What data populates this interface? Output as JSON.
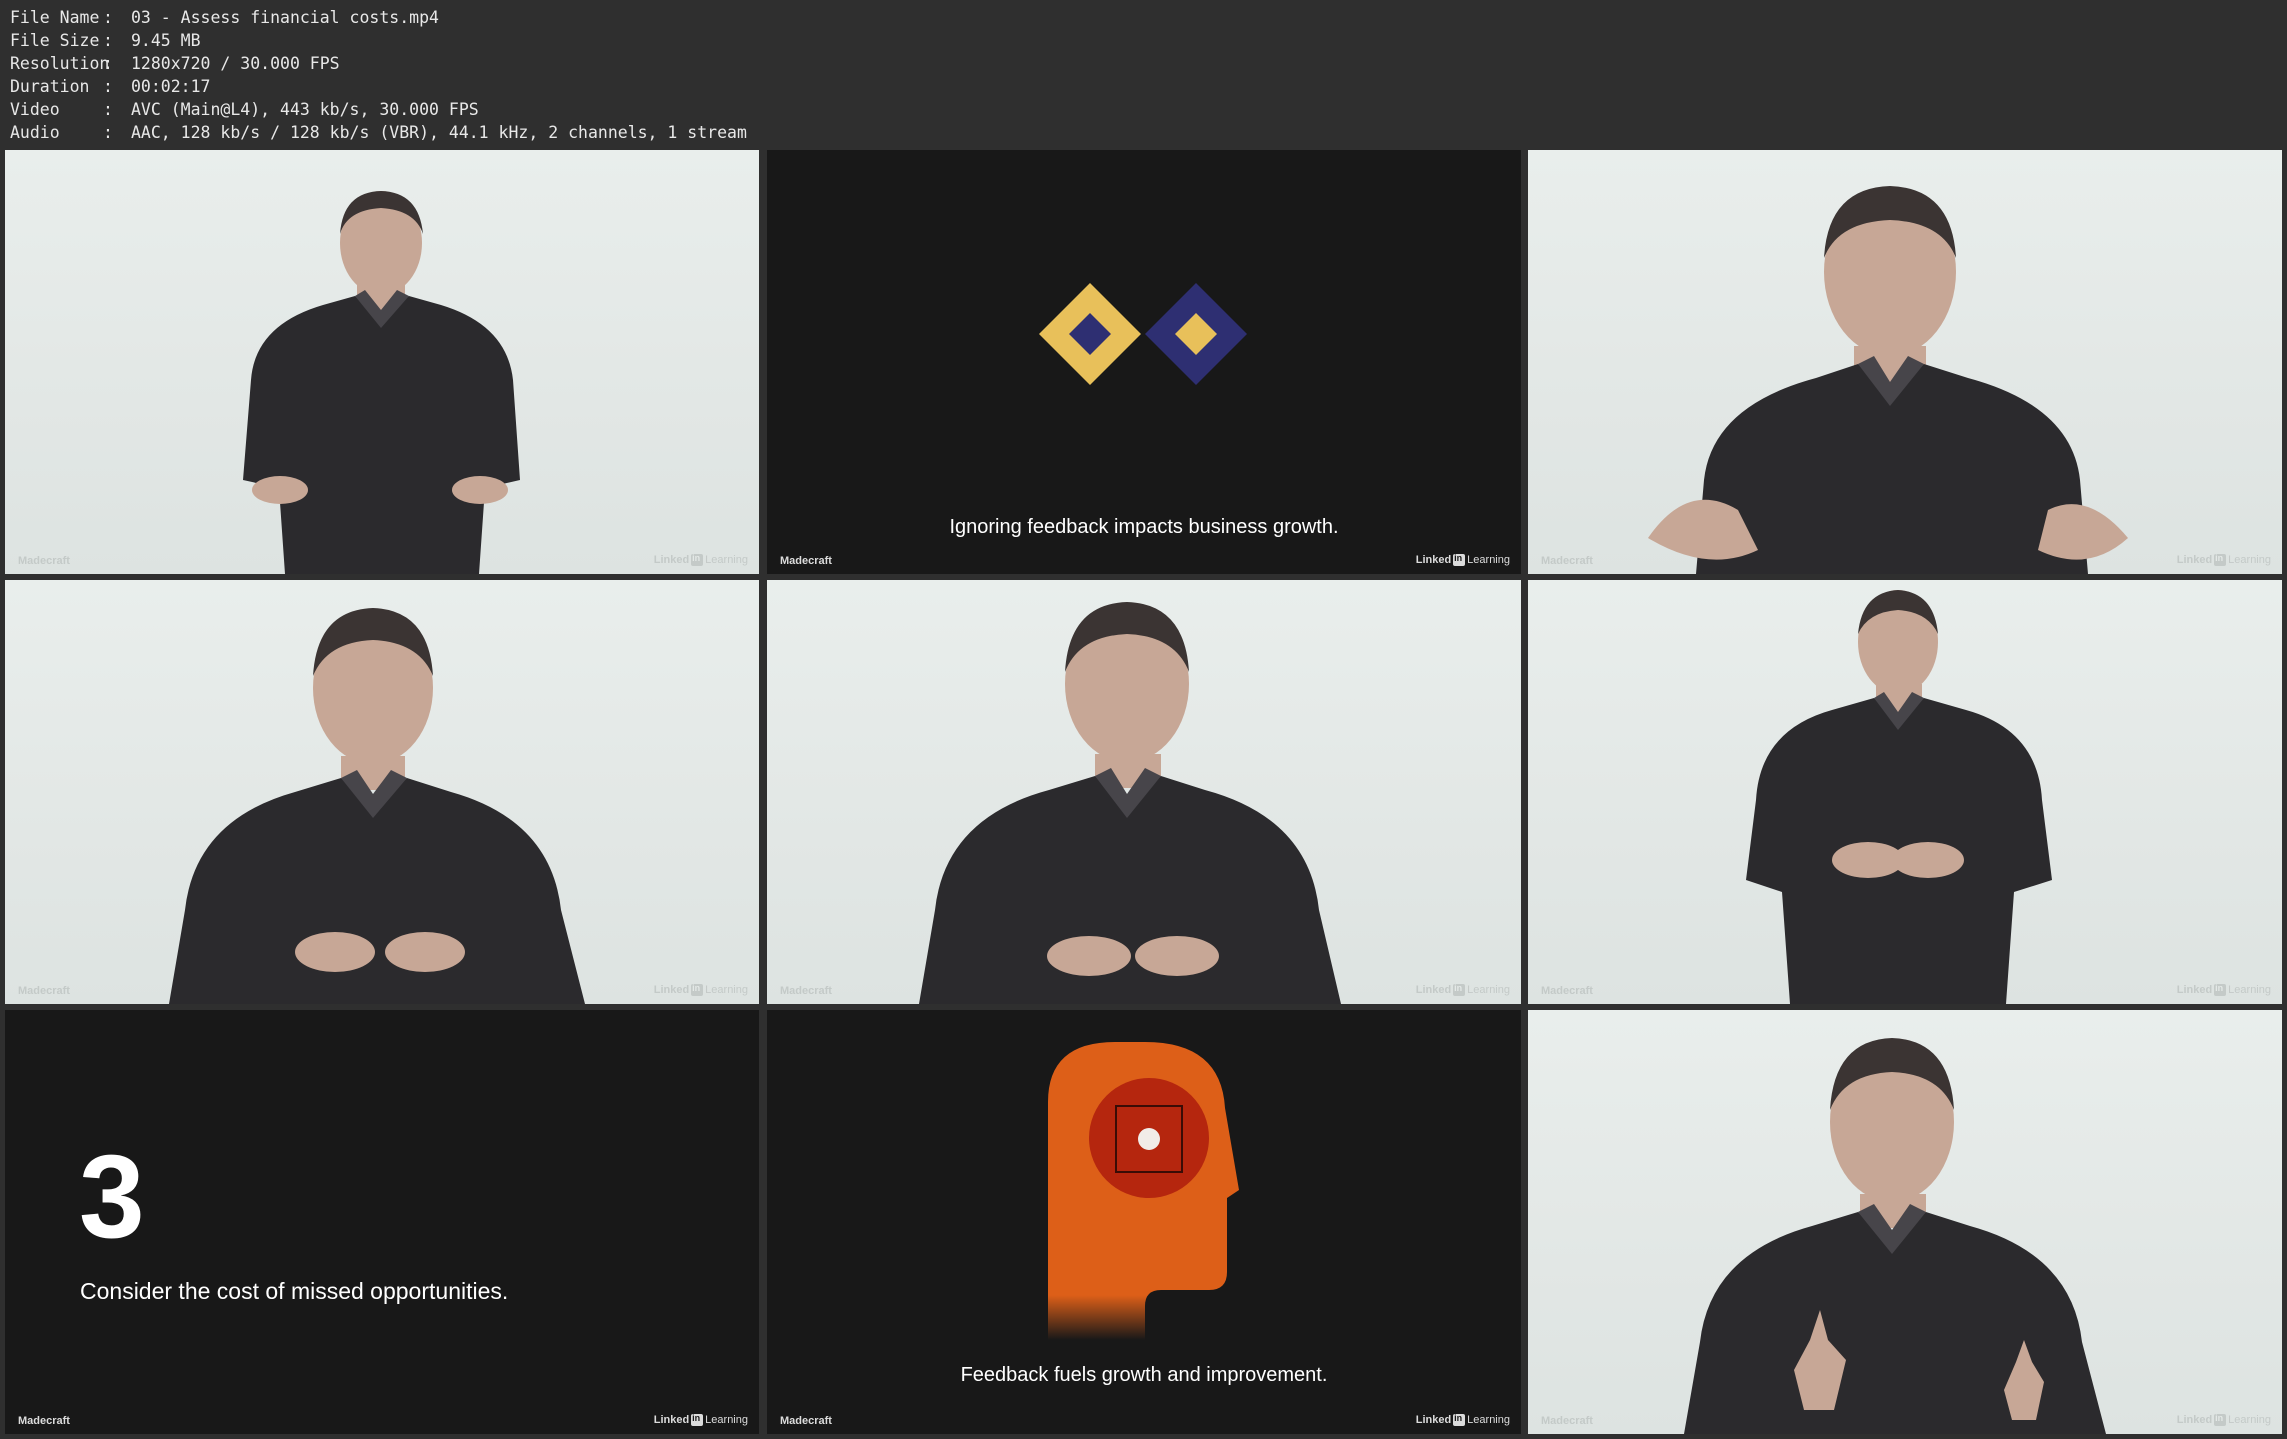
{
  "info": [
    {
      "key": "File Name",
      "value": "03 - Assess financial costs.mp4"
    },
    {
      "key": "File Size",
      "value": "9.45 MB"
    },
    {
      "key": "Resolution",
      "value": "1280x720 / 30.000 FPS"
    },
    {
      "key": "Duration",
      "value": "00:02:17"
    },
    {
      "key": "Video",
      "value": "AVC (Main@L4), 443 kb/s, 30.000 FPS"
    },
    {
      "key": "Audio",
      "value": "AAC, 128 kb/s / 128 kb/s (VBR), 44.1 kHz, 2 channels, 1 stream"
    }
  ],
  "watermark": {
    "left": "Madecraft",
    "right_a": "Linked",
    "right_b": "Learning"
  },
  "thumbs": [
    {
      "kind": "presenter"
    },
    {
      "kind": "slide",
      "caption": "Ignoring feedback impacts business growth."
    },
    {
      "kind": "presenter"
    },
    {
      "kind": "presenter"
    },
    {
      "kind": "presenter"
    },
    {
      "kind": "presenter"
    },
    {
      "kind": "point",
      "number": "3",
      "text": "Consider the cost of missed opportunities."
    },
    {
      "kind": "slide",
      "caption": "Feedback fuels growth and improvement."
    },
    {
      "kind": "presenter"
    }
  ],
  "colors": {
    "gold": "#e8c05a",
    "navy": "#2e2f72",
    "orange": "#dd5f18",
    "red": "#b5260e"
  }
}
